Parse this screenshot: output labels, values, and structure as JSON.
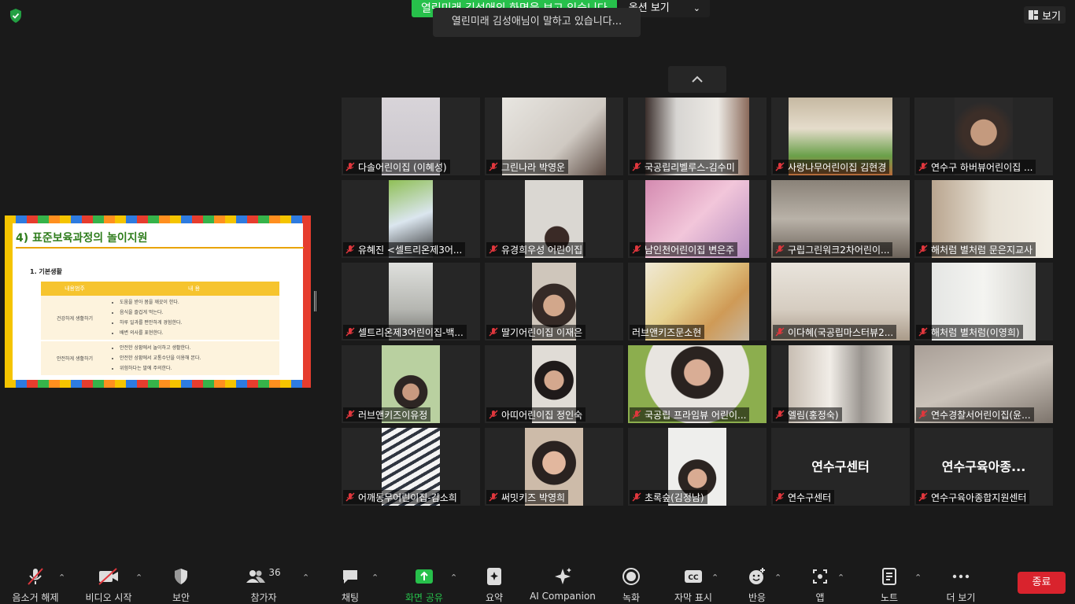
{
  "banner": {
    "sharing_text": "열린미래 김성애의 화면을 보고 있습니다",
    "options_label": "옵션 보기",
    "tooltip": "열린미래 김성애님이 말하고 있습니다..."
  },
  "view_label": "보기",
  "slide": {
    "title": "4) 표준보육과정의 놀이지원",
    "subtitle": "1. 기본생활",
    "table_headers": [
      "내용범주",
      "내 용"
    ],
    "rows": [
      {
        "category": "건강하게 생활하기",
        "items": [
          "도움을 받아 몸을 깨끗이 한다.",
          "음식을 즐겁게 먹는다.",
          "하루 일과를 편안하게 경험한다.",
          "배변 의사를 표현한다."
        ]
      },
      {
        "category": "안전하게 생활하기",
        "items": [
          "안전한 상황에서 놀이하고 생활한다.",
          "안전한 상황에서 교통수단을 이용해 본다.",
          "위험하다는 말에 주의한다."
        ]
      }
    ]
  },
  "participants": [
    {
      "name": "다솔어린이집 (이혜성)"
    },
    {
      "name": "그린나라 박영운"
    },
    {
      "name": "국공립리벨루스-김수미"
    },
    {
      "name": "사랑나무어린이집 김현경"
    },
    {
      "name": "연수구 하버뷰어린이집 ..."
    },
    {
      "name": "유혜진 <셀트리온제3어..."
    },
    {
      "name": "유경희우성 어린이집"
    },
    {
      "name": "남인천어린이집 변은주"
    },
    {
      "name": "구립그린워크2차어린이..."
    },
    {
      "name": "해처럼 별처럼 문은지교사"
    },
    {
      "name": "셀트리온제3어린이집-백..."
    },
    {
      "name": "딸기어린이집 이재은"
    },
    {
      "name": "러브앤키즈문소현"
    },
    {
      "name": "이다혜(국공립마스터뷰2..."
    },
    {
      "name": "해처럼 별처럼(이영희)"
    },
    {
      "name": "러브앤키즈이유정"
    },
    {
      "name": "아띠어린이집 정인숙"
    },
    {
      "name": "국공립 프라임뷰 어린이..."
    },
    {
      "name": "엘림(홍정숙)"
    },
    {
      "name": "연수경찰서어린이집(윤..."
    },
    {
      "name": "어깨동무어린이집-김소희"
    },
    {
      "name": "써밋키즈 박영희"
    },
    {
      "name": "초록숲(김정남)"
    },
    {
      "name": "연수구센터",
      "display": "연수구센터"
    },
    {
      "name": "연수구육아종합지원센터",
      "display": "연수구육아종..."
    }
  ],
  "toolbar": {
    "unmute": "음소거 해제",
    "start_video": "비디오 시작",
    "security": "보안",
    "participants": "참가자",
    "participants_count": "36",
    "chat": "채팅",
    "share_screen": "화면 공유",
    "summary": "요약",
    "ai_companion": "AI Companion",
    "record": "녹화",
    "captions": "자막 표시",
    "reactions": "반응",
    "apps": "앱",
    "notes": "노트",
    "more": "더 보기",
    "end": "종료"
  },
  "colors": {
    "share_green": "#27c04b",
    "end_red": "#d9232d",
    "muted_red": "#e0373d",
    "background": "#1a1a1a",
    "slide_green": "#2f7d1d",
    "table_header": "#f6c42e"
  }
}
